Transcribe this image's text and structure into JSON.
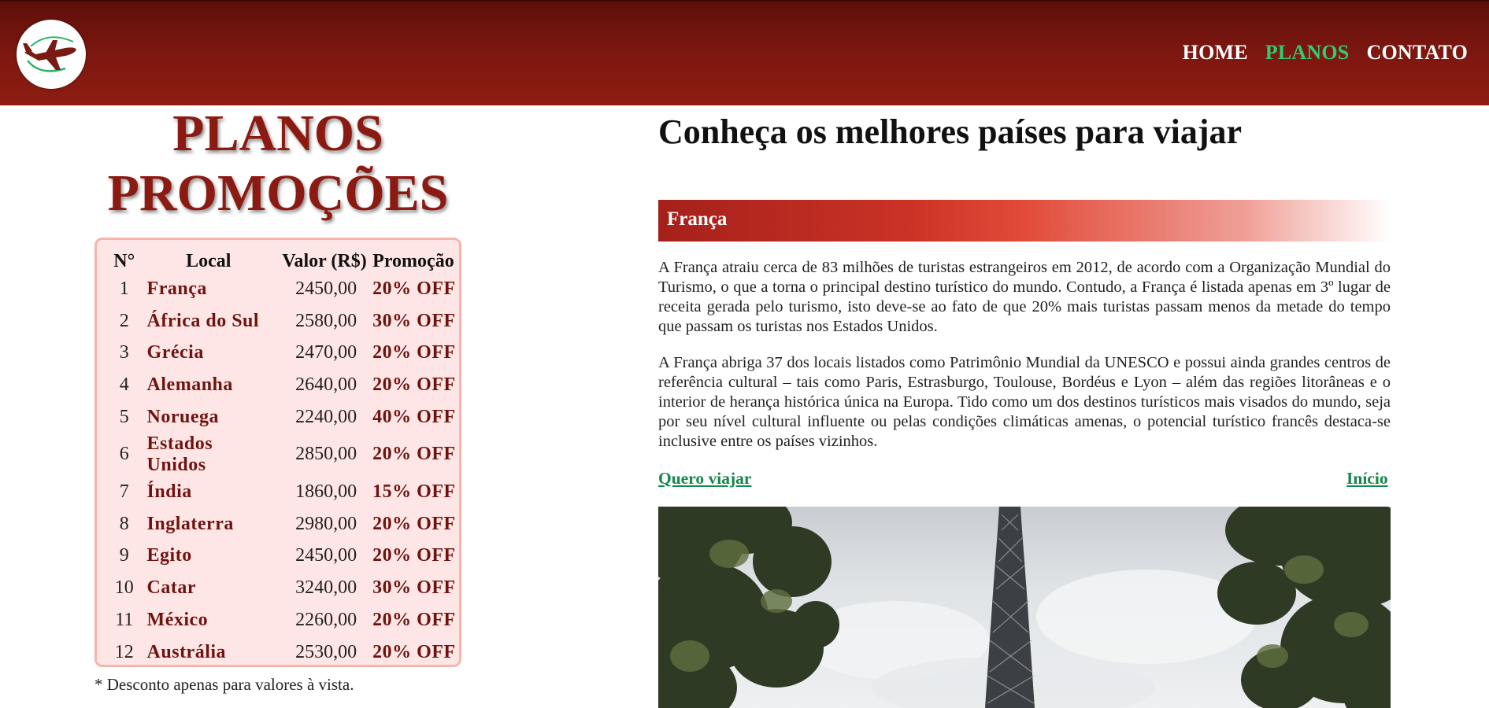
{
  "header": {
    "logo_icon": "airplane-logo-icon",
    "nav": [
      {
        "label": "HOME",
        "active": false
      },
      {
        "label": "PLANOS",
        "active": true
      },
      {
        "label": "CONTATO",
        "active": false
      }
    ],
    "colors": {
      "header_bg": "#7d1710",
      "nav_active": "#2ecc71"
    }
  },
  "plans": {
    "title_line1": "PLANOS",
    "title_line2": "PROMOÇÕES",
    "columns": [
      "N°",
      "Local",
      "Valor (R$)",
      "Promoção"
    ],
    "rows": [
      {
        "n": "1",
        "local": "França",
        "valor": "2450,00",
        "promo": "20% OFF"
      },
      {
        "n": "2",
        "local": "África do Sul",
        "valor": "2580,00",
        "promo": "30% OFF"
      },
      {
        "n": "3",
        "local": "Grécia",
        "valor": "2470,00",
        "promo": "20% OFF"
      },
      {
        "n": "4",
        "local": "Alemanha",
        "valor": "2640,00",
        "promo": "20% OFF"
      },
      {
        "n": "5",
        "local": "Noruega",
        "valor": "2240,00",
        "promo": "40% OFF"
      },
      {
        "n": "6",
        "local": "Estados Unidos",
        "valor": "2850,00",
        "promo": "20% OFF"
      },
      {
        "n": "7",
        "local": "Índia",
        "valor": "1860,00",
        "promo": "15% OFF"
      },
      {
        "n": "8",
        "local": "Inglaterra",
        "valor": "2980,00",
        "promo": "20% OFF"
      },
      {
        "n": "9",
        "local": "Egito",
        "valor": "2450,00",
        "promo": "20% OFF"
      },
      {
        "n": "10",
        "local": "Catar",
        "valor": "3240,00",
        "promo": "30% OFF"
      },
      {
        "n": "11",
        "local": "México",
        "valor": "2260,00",
        "promo": "20% OFF"
      },
      {
        "n": "12",
        "local": "Austrália",
        "valor": "2530,00",
        "promo": "20% OFF"
      }
    ],
    "footnote": "* Desconto apenas para valores à vista."
  },
  "main": {
    "title": "Conheça os melhores países para viajar",
    "country": "França",
    "paragraphs": [
      "A França atraiu cerca de 83 milhões de turistas estrangeiros em 2012, de acordo com a Organização Mundial do Turismo, o que a torna o principal destino turístico do mundo. Contudo, a França é listada apenas em 3º lugar de receita gerada pelo turismo, isto deve-se ao fato de que 20% mais turistas passam menos da metade do tempo que passam os turistas nos Estados Unidos.",
      "A França abriga 37 dos locais listados como Patrimônio Mundial da UNESCO e possui ainda grandes centros de referência cultural – tais como Paris, Estrasburgo, Toulouse, Bordéus e Lyon – além das regiões litorâneas e o interior de herança histórica única na Europa. Tido como um dos destinos turísticos mais visados do mundo, seja por seu nível cultural influente ou pelas condições climáticas amenas, o potencial turístico francês destaca-se inclusive entre os países vizinhos."
    ],
    "link_travel": "Quero viajar",
    "link_top": "Início",
    "photo_subject": "eiffel-tower-photo"
  }
}
